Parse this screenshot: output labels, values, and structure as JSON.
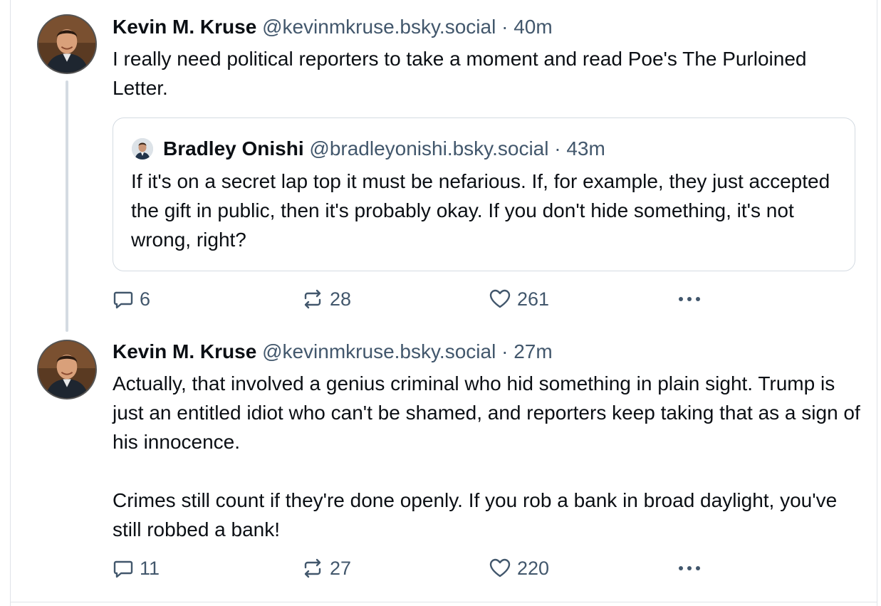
{
  "posts": [
    {
      "author": {
        "name": "Kevin M. Kruse",
        "handle": "@kevinmkruse.bsky.social",
        "avatar_icon": "author-avatar"
      },
      "separator": "·",
      "time": "40m",
      "text": [
        "I really need political reporters to take a moment and read Poe's The Purloined Letter."
      ],
      "quote": {
        "author": {
          "name": "Bradley Onishi",
          "handle": "@bradleyonishi.bsky.social",
          "avatar_icon": "quoted-author-avatar"
        },
        "separator": "·",
        "time": "43m",
        "text": "If it's on a secret lap top it must be nefarious. If, for example, they just accepted the gift in public, then it's probably okay. If you don't hide something, it's not wrong, right?"
      },
      "actions": {
        "replies": "6",
        "reposts": "28",
        "likes": "261",
        "reply_icon": "reply-icon",
        "repost_icon": "repost-icon",
        "like_icon": "heart-icon",
        "more_icon": "more-options-icon"
      }
    },
    {
      "author": {
        "name": "Kevin M. Kruse",
        "handle": "@kevinmkruse.bsky.social",
        "avatar_icon": "author-avatar"
      },
      "separator": "·",
      "time": "27m",
      "text": [
        "Actually, that involved a genius criminal who hid something in plain sight. Trump is just an entitled idiot who can't be shamed, and reporters keep taking that as a sign of his innocence.",
        "Crimes still count if they're done openly. If you rob a bank in broad daylight, you've still robbed a bank!"
      ],
      "actions": {
        "replies": "11",
        "reposts": "27",
        "likes": "220",
        "reply_icon": "reply-icon",
        "repost_icon": "repost-icon",
        "like_icon": "heart-icon",
        "more_icon": "more-options-icon"
      }
    }
  ],
  "colors": {
    "text": "#0b0f14",
    "muted": "#42576c",
    "border": "#d4dbe2",
    "thread_line": "#d4dbe2"
  }
}
